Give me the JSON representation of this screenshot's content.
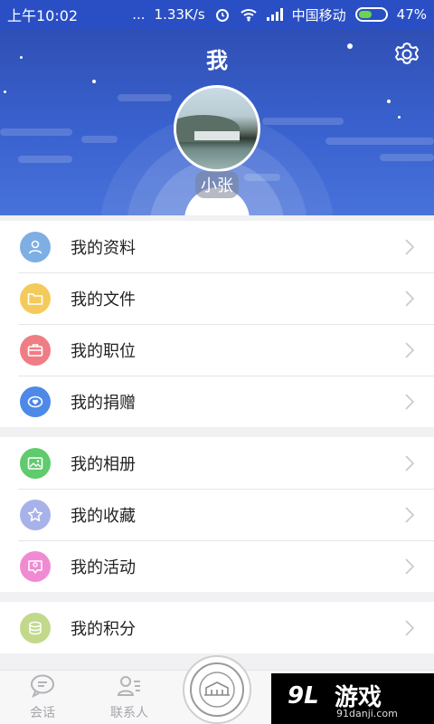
{
  "status_bar": {
    "time": "上午10:02",
    "dots": "...",
    "speed": "1.33K/s",
    "carrier": "中国移动",
    "battery": "47%"
  },
  "header": {
    "title": "我",
    "username": "小张"
  },
  "menu_groups": [
    [
      {
        "label": "我的资料",
        "icon": "user-icon",
        "color": "#7eaee4"
      },
      {
        "label": "我的文件",
        "icon": "folder-icon",
        "color": "#f4cb5a"
      },
      {
        "label": "我的职位",
        "icon": "briefcase-icon",
        "color": "#ef7d84"
      },
      {
        "label": "我的捐赠",
        "icon": "heart-icon",
        "color": "#4e89e8"
      }
    ],
    [
      {
        "label": "我的相册",
        "icon": "photo-icon",
        "color": "#5fcb6c"
      },
      {
        "label": "我的收藏",
        "icon": "star-icon",
        "color": "#a8b2ea"
      },
      {
        "label": "我的活动",
        "icon": "activity-icon",
        "color": "#f08bd3"
      }
    ],
    [
      {
        "label": "我的积分",
        "icon": "coins-icon",
        "color": "#c2d98b"
      }
    ]
  ],
  "tabbar": {
    "tabs": [
      {
        "label": "会话",
        "icon": "chat-icon"
      },
      {
        "label": "联系人",
        "icon": "contacts-icon"
      }
    ]
  },
  "watermark": {
    "logo": "9L",
    "brand": "游戏",
    "url": "91danji.com"
  },
  "colors": {
    "header_top": "#2f4fb4",
    "header_bottom": "#4872da",
    "background": "#f1f1f3"
  }
}
